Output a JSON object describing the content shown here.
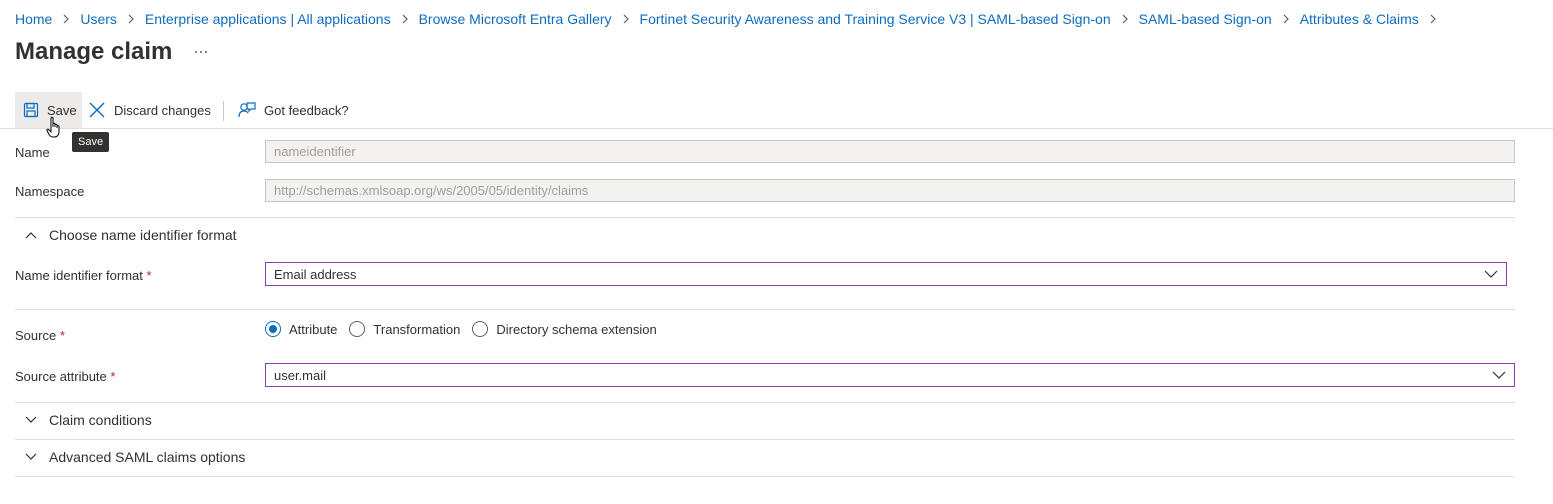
{
  "breadcrumb": {
    "items": [
      "Home",
      "Users",
      "Enterprise applications | All applications",
      "Browse Microsoft Entra Gallery",
      "Fortinet Security Awareness and Training Service V3 | SAML-based Sign-on",
      "SAML-based Sign-on",
      "Attributes & Claims"
    ]
  },
  "page": {
    "title": "Manage claim",
    "more": "···"
  },
  "toolbar": {
    "save": "Save",
    "discard": "Discard changes",
    "feedback": "Got feedback?",
    "tooltip": "Save"
  },
  "form": {
    "name_label": "Name",
    "name_value": "nameidentifier",
    "namespace_label": "Namespace",
    "namespace_value": "http://schemas.xmlsoap.org/ws/2005/05/identity/claims",
    "format_section": "Choose name identifier format",
    "format_label": "Name identifier format",
    "format_value": "Email address",
    "source_label": "Source",
    "source_options": [
      "Attribute",
      "Transformation",
      "Directory schema extension"
    ],
    "source_selected": "Attribute",
    "source_attr_label": "Source attribute",
    "source_attr_value": "user.mail",
    "required_mark": "*",
    "conditions_section": "Claim conditions",
    "advanced_section": "Advanced SAML claims options"
  },
  "colors": {
    "link": "#0f6cbd",
    "focus_border": "#8a3fb0",
    "required": "#a4262c"
  }
}
